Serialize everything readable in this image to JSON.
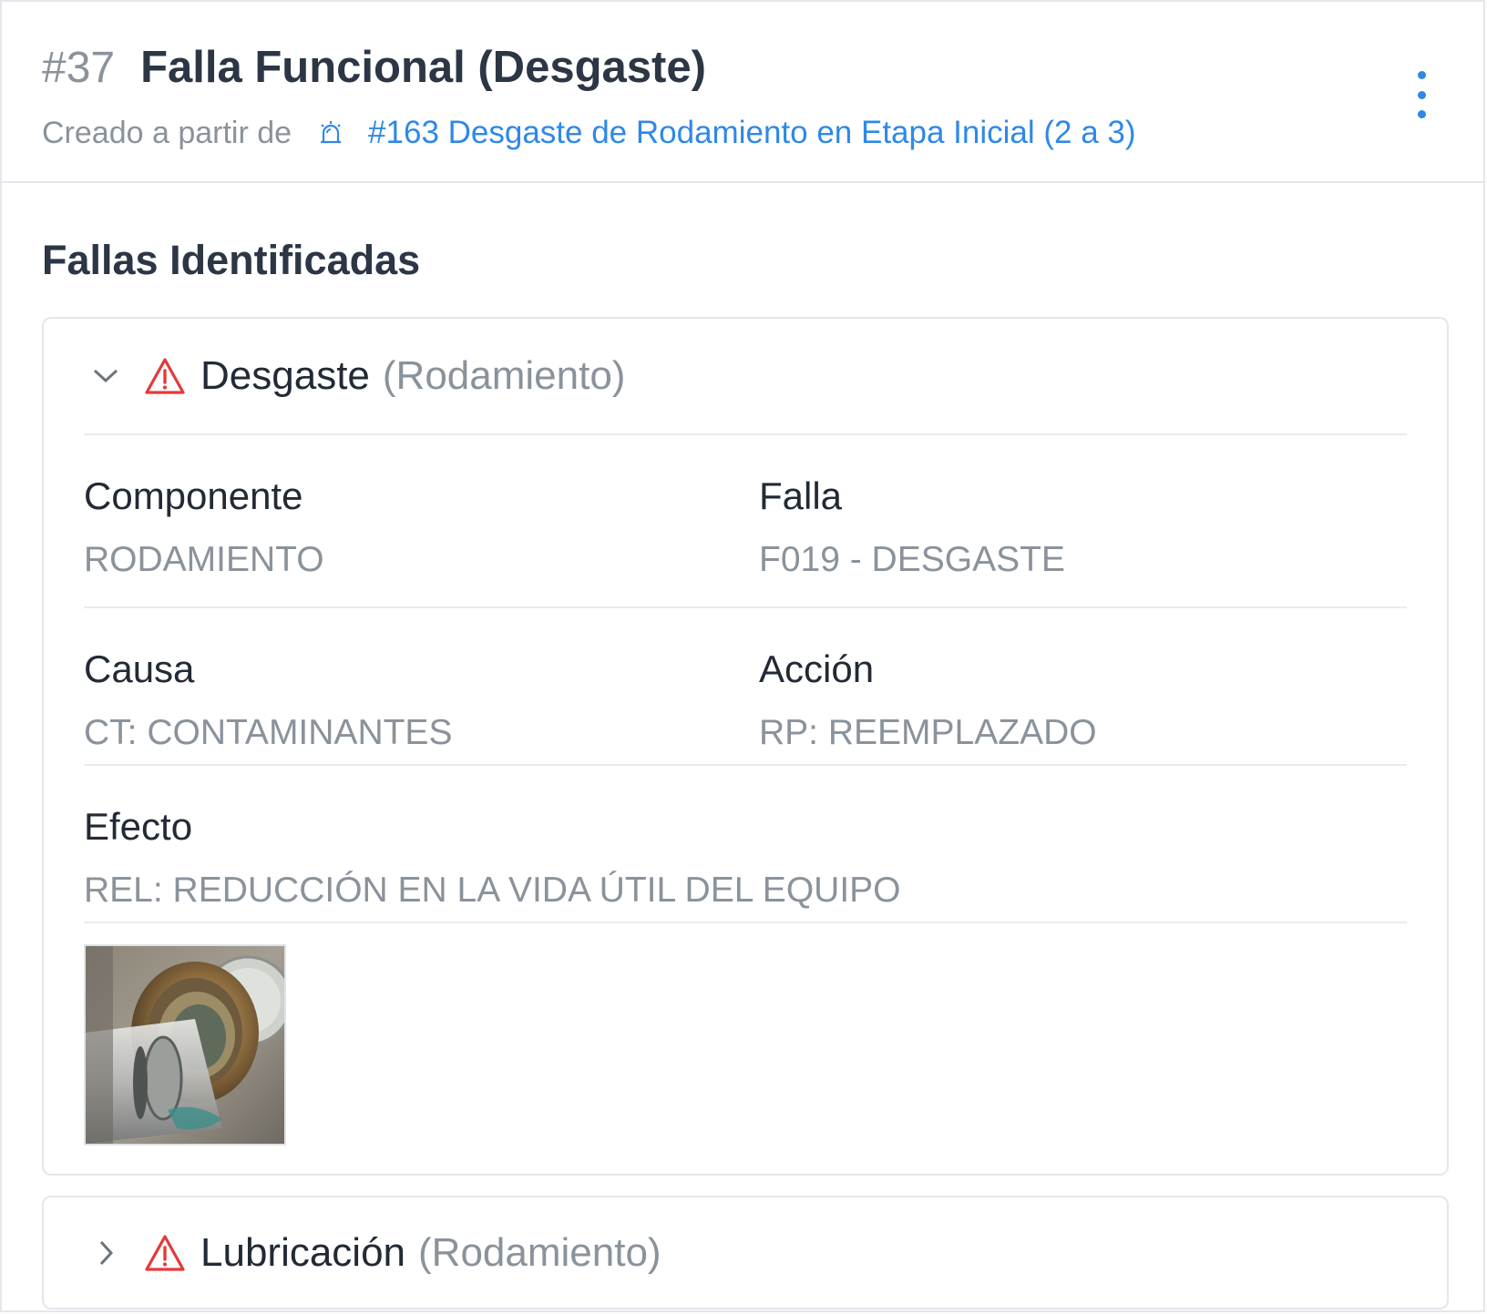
{
  "header": {
    "number": "#37",
    "title": "Falla Funcional (Desgaste)",
    "created_from_label": "Creado a partir de",
    "created_from_link": "#163 Desgaste de Rodamiento en Etapa Inicial (2 a 3)"
  },
  "section_title": "Fallas Identificadas",
  "failures": [
    {
      "name": "Desgaste",
      "component_paren": "(Rodamiento)",
      "expanded": true,
      "fields": {
        "componente_label": "Componente",
        "componente_value": "RODAMIENTO",
        "falla_label": "Falla",
        "falla_value": "F019 - DESGASTE",
        "causa_label": "Causa",
        "causa_value": "CT: CONTAMINANTES",
        "accion_label": "Acción",
        "accion_value": "RP: REEMPLAZADO",
        "efecto_label": "Efecto",
        "efecto_value": "REL: REDUCCIÓN EN LA VIDA ÚTIL DEL EQUIPO"
      }
    },
    {
      "name": "Lubricación",
      "component_paren": "(Rodamiento)",
      "expanded": false
    }
  ],
  "colors": {
    "link": "#2f88e8",
    "warning": "#e5393b",
    "title": "#2c3644",
    "muted": "#8a929b"
  },
  "icons": {
    "more": "more-vertical-icon",
    "alarm": "alarm-siren-icon",
    "warning": "warning-triangle-icon",
    "expand": "chevron-down-icon",
    "collapse": "chevron-right-icon"
  }
}
